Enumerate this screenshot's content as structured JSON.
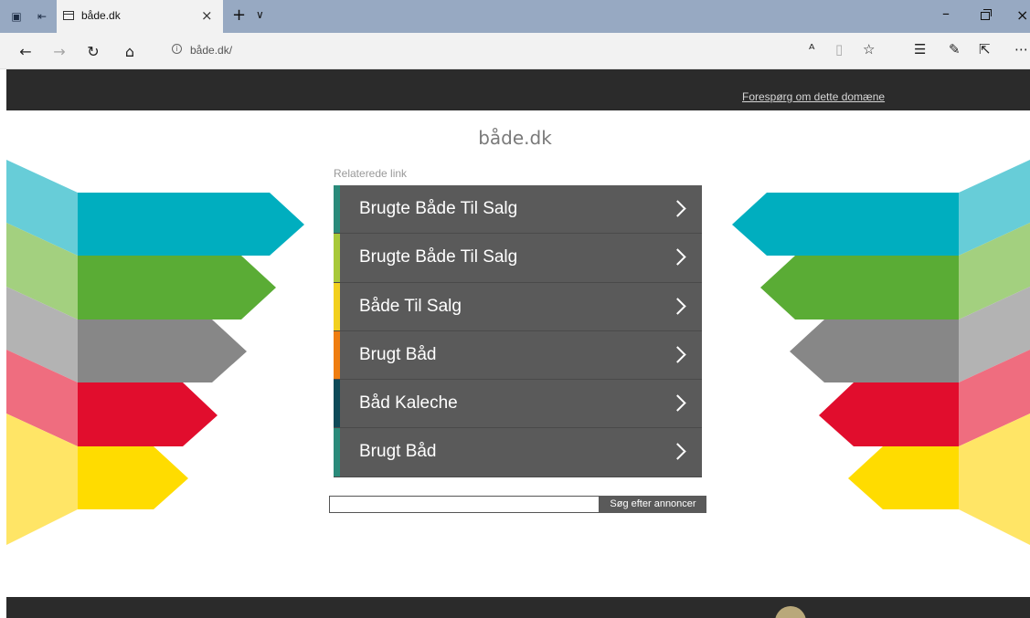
{
  "browser": {
    "tab_title": "både.dk",
    "url": "både.dk/"
  },
  "page": {
    "inquiry_link": "Forespørg om dette domæne",
    "site_title": "både.dk",
    "section_label": "Relaterede link",
    "links": [
      {
        "label": "Brugte Både Til Salg",
        "color": "#2a8a7a"
      },
      {
        "label": "Brugte Både Til Salg",
        "color": "#a8c93a"
      },
      {
        "label": "Både Til Salg",
        "color": "#f2d01e"
      },
      {
        "label": "Brugt Båd",
        "color": "#ef7d10"
      },
      {
        "label": "Båd Kaleche",
        "color": "#0e4a58"
      },
      {
        "label": "Brugt Båd",
        "color": "#2a8a7a"
      }
    ],
    "search_button": "Søg efter annoncer",
    "search_value": ""
  },
  "colors": {
    "header": "#2b2b2b",
    "row_bg": "#5a5a5a",
    "arrow_teal": "#00aebf",
    "arrow_green": "#5aac35",
    "arrow_grey": "#878787",
    "arrow_red": "#e10d2d",
    "arrow_yellow": "#ffdc00"
  }
}
